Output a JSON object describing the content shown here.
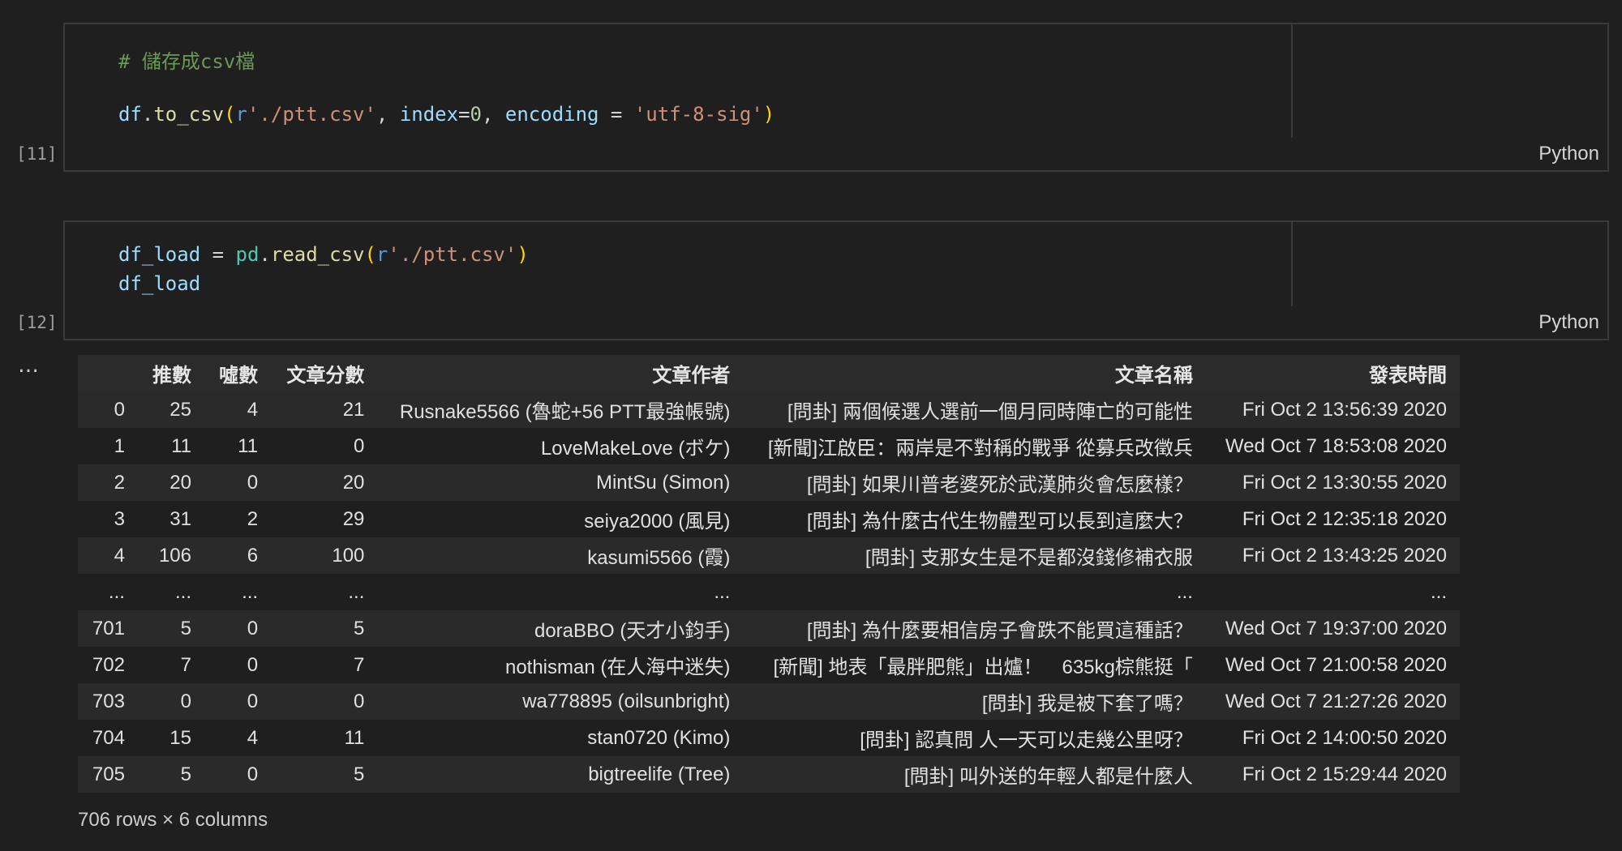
{
  "cells": [
    {
      "exec_count": "[11]",
      "language": "Python",
      "comment": "# 儲存成csv檔",
      "code2": {
        "df": "df",
        "dot1": ".",
        "fn": "to_csv",
        "lp": "(",
        "r": "r",
        "path": "'./ptt.csv'",
        "comma1": ", ",
        "index_kw": "index",
        "eq1": "=",
        "zero": "0",
        "comma2": ", ",
        "enc_kw": "encoding",
        "eq2": " = ",
        "enc": "'utf-8-sig'",
        "rp": ")"
      }
    },
    {
      "exec_count": "[12]",
      "language": "Python",
      "line1": {
        "var": "df_load",
        "eq": " = ",
        "mod": "pd",
        "dot": ".",
        "fn": "read_csv",
        "lp": "(",
        "r": "r",
        "path": "'./ptt.csv'",
        "rp": ")"
      },
      "line2": "df_load"
    }
  ],
  "output": {
    "more_icon": "…",
    "columns": [
      "",
      "推數",
      "噓數",
      "文章分數",
      "文章作者",
      "文章名稱",
      "發表時間"
    ],
    "rows": [
      [
        "0",
        "25",
        "4",
        "21",
        "Rusnake5566 (魯蛇+56 PTT最強帳號)",
        "[問卦] 兩個候選人選前一個月同時陣亡的可能性",
        "Fri Oct 2 13:56:39 2020"
      ],
      [
        "1",
        "11",
        "11",
        "0",
        "LoveMakeLove (ボケ)",
        "[新聞]江啟臣：兩岸是不對稱的戰爭 從募兵改徵兵",
        "Wed Oct 7 18:53:08 2020"
      ],
      [
        "2",
        "20",
        "0",
        "20",
        "MintSu (Simon)",
        "[問卦] 如果川普老婆死於武漢肺炎會怎麼樣？",
        "Fri Oct 2 13:30:55 2020"
      ],
      [
        "3",
        "31",
        "2",
        "29",
        "seiya2000 (風見)",
        "[問卦] 為什麼古代生物體型可以長到這麼大？",
        "Fri Oct 2 12:35:18 2020"
      ],
      [
        "4",
        "106",
        "6",
        "100",
        "kasumi5566 (霞)",
        "[問卦] 支那女生是不是都沒錢修補衣服",
        "Fri Oct 2 13:43:25 2020"
      ],
      [
        "...",
        "...",
        "...",
        "...",
        "...",
        "...",
        "..."
      ],
      [
        "701",
        "5",
        "0",
        "5",
        "doraBBO (天才小鈞手)",
        "[問卦] 為什麼要相信房子會跌不能買這種話？",
        "Wed Oct 7 19:37:00 2020"
      ],
      [
        "702",
        "7",
        "0",
        "7",
        "nothisman (在人海中迷失)",
        "[新聞] 地表「最胖肥熊」出爐！　635kg棕熊挺「",
        "Wed Oct 7 21:00:58 2020"
      ],
      [
        "703",
        "0",
        "0",
        "0",
        "wa778895 (oilsunbright)",
        "[問卦] 我是被下套了嗎？",
        "Wed Oct 7 21:27:26 2020"
      ],
      [
        "704",
        "15",
        "4",
        "11",
        "stan0720 (Kimo)",
        "[問卦] 認真問 人一天可以走幾公里呀？",
        "Fri Oct 2 14:00:50 2020"
      ],
      [
        "705",
        "5",
        "0",
        "5",
        "bigtreelife (Tree)",
        "[問卦] 叫外送的年輕人都是什麼人",
        "Fri Oct 2 15:29:44 2020"
      ]
    ],
    "shape_note": "706 rows × 6 columns"
  }
}
